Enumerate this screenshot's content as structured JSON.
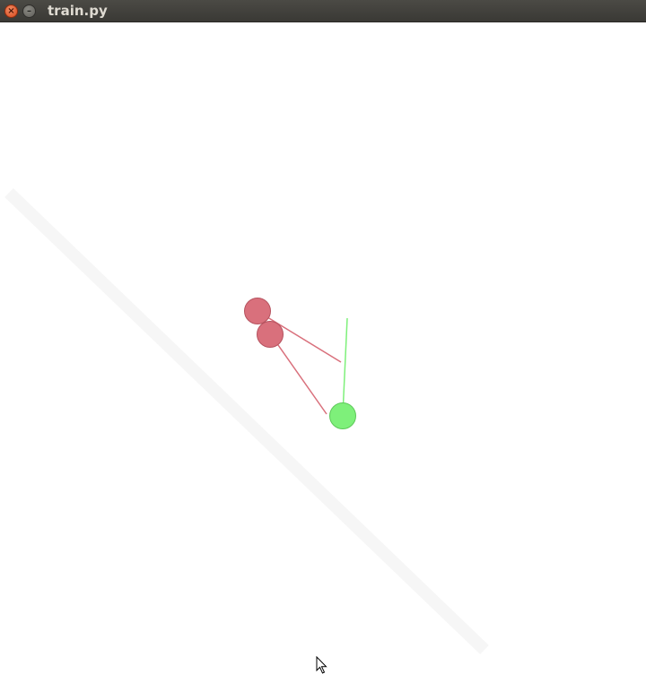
{
  "window": {
    "title": "train.py",
    "close_glyph": "×",
    "minimize_glyph": "–"
  },
  "scene": {
    "background": "#ffffff",
    "agent_color": "#7ef07a",
    "enemy_color": "#d9707c",
    "agent_ray_color": "#7ef07a",
    "enemy_ray_color": "#d9707c"
  },
  "icons": {
    "close": "close-icon",
    "minimize": "minimize-icon",
    "cursor": "mouse-pointer-icon"
  }
}
